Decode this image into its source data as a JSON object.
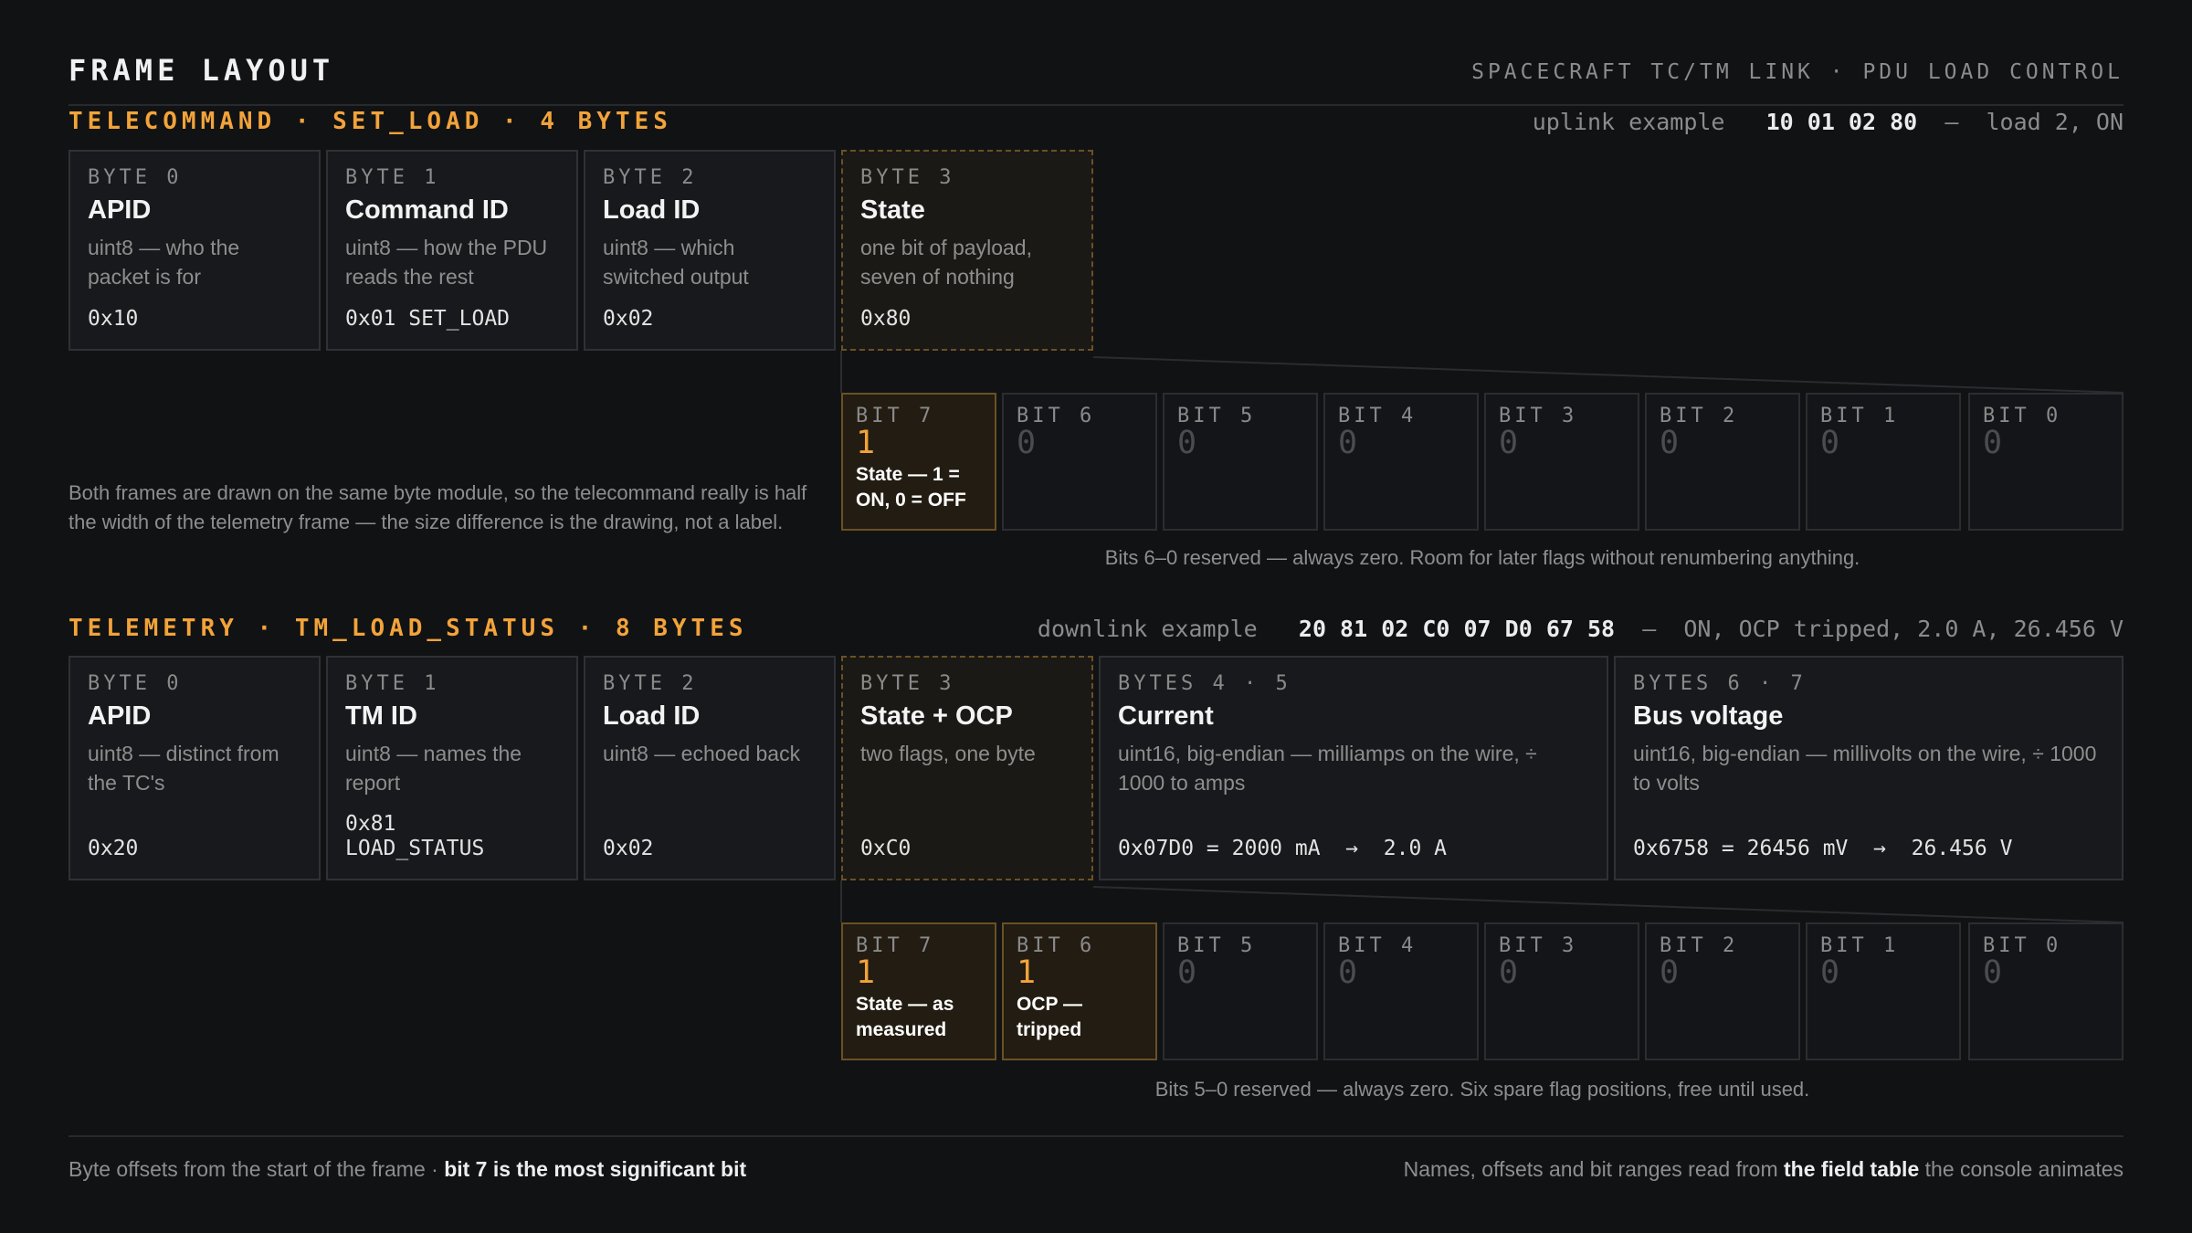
{
  "header": {
    "title": "FRAME LAYOUT",
    "subtitle": "SPACECRAFT TC/TM LINK · PDU LOAD CONTROL"
  },
  "telecommand": {
    "title": "TELECOMMAND · SET_LOAD · 4 BYTES",
    "example": {
      "label": "uplink example",
      "hex": "10 01 02 80",
      "sep": "—",
      "meaning": "load 2, ON"
    },
    "bytes": [
      {
        "label": "BYTE 0",
        "name": "APID",
        "desc": "uint8 — who the packet is for",
        "value": "0x10"
      },
      {
        "label": "BYTE 1",
        "name": "Command ID",
        "desc": "uint8 — how the PDU reads the rest",
        "value": "0x01 SET_LOAD"
      },
      {
        "label": "BYTE 2",
        "name": "Load ID",
        "desc": "uint8 — which switched output",
        "value": "0x02"
      },
      {
        "label": "BYTE 3",
        "name": "State",
        "desc": "one bit of payload, seven of nothing",
        "value": "0x80"
      }
    ],
    "bits": [
      {
        "label": "BIT 7",
        "value": "1",
        "set": true,
        "desc": "State — 1 = ON, 0 = OFF"
      },
      {
        "label": "BIT 6",
        "value": "0",
        "set": false,
        "desc": ""
      },
      {
        "label": "BIT 5",
        "value": "0",
        "set": false,
        "desc": ""
      },
      {
        "label": "BIT 4",
        "value": "0",
        "set": false,
        "desc": ""
      },
      {
        "label": "BIT 3",
        "value": "0",
        "set": false,
        "desc": ""
      },
      {
        "label": "BIT 2",
        "value": "0",
        "set": false,
        "desc": ""
      },
      {
        "label": "BIT 1",
        "value": "0",
        "set": false,
        "desc": ""
      },
      {
        "label": "BIT 0",
        "value": "0",
        "set": false,
        "desc": ""
      }
    ],
    "bits_note": "Bits 6–0 reserved — always zero. Room for later flags without renumbering anything.",
    "side_note": "Both frames are drawn on the same byte module, so the telecommand really is half the width of the telemetry frame — the size difference is the drawing, not a label."
  },
  "telemetry": {
    "title": "TELEMETRY · TM_LOAD_STATUS · 8 BYTES",
    "example": {
      "label": "downlink example",
      "hex": "20 81 02 C0 07 D0 67 58",
      "sep": "—",
      "meaning": "ON, OCP tripped, 2.0 A, 26.456 V"
    },
    "bytes": [
      {
        "label": "BYTE 0",
        "name": "APID",
        "desc": "uint8 — distinct from the TC's",
        "value": "0x20"
      },
      {
        "label": "BYTE 1",
        "name": "TM ID",
        "desc": "uint8 — names the report",
        "value": "0x81\nLOAD_STATUS"
      },
      {
        "label": "BYTE 2",
        "name": "Load ID",
        "desc": "uint8 — echoed back",
        "value": "0x02"
      },
      {
        "label": "BYTE 3",
        "name": "State + OCP",
        "desc": "two flags, one byte",
        "value": "0xC0"
      },
      {
        "label": "BYTES 4 · 5",
        "name": "Current",
        "desc": "uint16, big-endian — milliamps on the wire, ÷ 1000 to amps",
        "value": "0x07D0 = 2000 mA  →  2.0 A"
      },
      {
        "label": "BYTES 6 · 7",
        "name": "Bus voltage",
        "desc": "uint16, big-endian — millivolts on the wire, ÷ 1000 to volts",
        "value": "0x6758 = 26456 mV  →  26.456 V"
      }
    ],
    "bits": [
      {
        "label": "BIT 7",
        "value": "1",
        "set": true,
        "desc": "State — as measured"
      },
      {
        "label": "BIT 6",
        "value": "1",
        "set": true,
        "desc": "OCP — tripped"
      },
      {
        "label": "BIT 5",
        "value": "0",
        "set": false,
        "desc": ""
      },
      {
        "label": "BIT 4",
        "value": "0",
        "set": false,
        "desc": ""
      },
      {
        "label": "BIT 3",
        "value": "0",
        "set": false,
        "desc": ""
      },
      {
        "label": "BIT 2",
        "value": "0",
        "set": false,
        "desc": ""
      },
      {
        "label": "BIT 1",
        "value": "0",
        "set": false,
        "desc": ""
      },
      {
        "label": "BIT 0",
        "value": "0",
        "set": false,
        "desc": ""
      }
    ],
    "bits_note": "Bits 5–0 reserved — always zero. Six spare flag positions, free until used."
  },
  "footer": {
    "left_text": "Byte offsets from the start of the frame · ",
    "left_strong": "bit 7 is the most significant bit",
    "right_text_1": "Names, offsets and bit ranges read from ",
    "right_strong": "the field table",
    "right_text_2": " the console animates"
  }
}
